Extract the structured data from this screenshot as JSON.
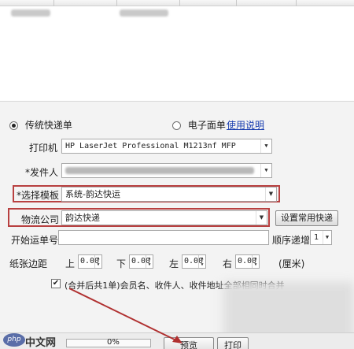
{
  "order_list": {
    "visible_rows": 1
  },
  "form": {
    "radio_traditional_label": "传统快递单",
    "radio_electronic_label": "电子面单",
    "help_link": "使用说明",
    "printer_label": "打印机",
    "printer_value": "HP LaserJet Professional M1213nf MFP",
    "sender_label": "*发件人",
    "template_label": "*选择模板",
    "template_value": "系统-韵达快运",
    "logistics_label": "物流公司",
    "logistics_value": "韵达快递",
    "set_common_courier_button": "设置常用快递",
    "start_waybill_label": "开始运单号",
    "start_waybill_value": "",
    "sequence_label": "顺序递增",
    "sequence_value": "1",
    "margin_label": "纸张边距",
    "margin_top_label": "上",
    "margin_top_value": "0.00",
    "margin_bottom_label": "下",
    "margin_bottom_value": "0.00",
    "margin_left_label": "左",
    "margin_left_value": "0.00",
    "margin_right_label": "右",
    "margin_right_value": "0.00",
    "margin_unit": "(厘米)",
    "merge_checked": true,
    "merge_text": "(合并后共1单)会员名、收件人、收件地址全部相同时合并"
  },
  "bottom": {
    "progress_percent_text": "0%",
    "preview_button": "预览",
    "print_button": "打印",
    "logo_text": "中文网",
    "logo_mark": "php"
  },
  "colors": {
    "highlight_border": "#b84040",
    "arrow": "#b03030",
    "link": "#1a3fb0"
  }
}
